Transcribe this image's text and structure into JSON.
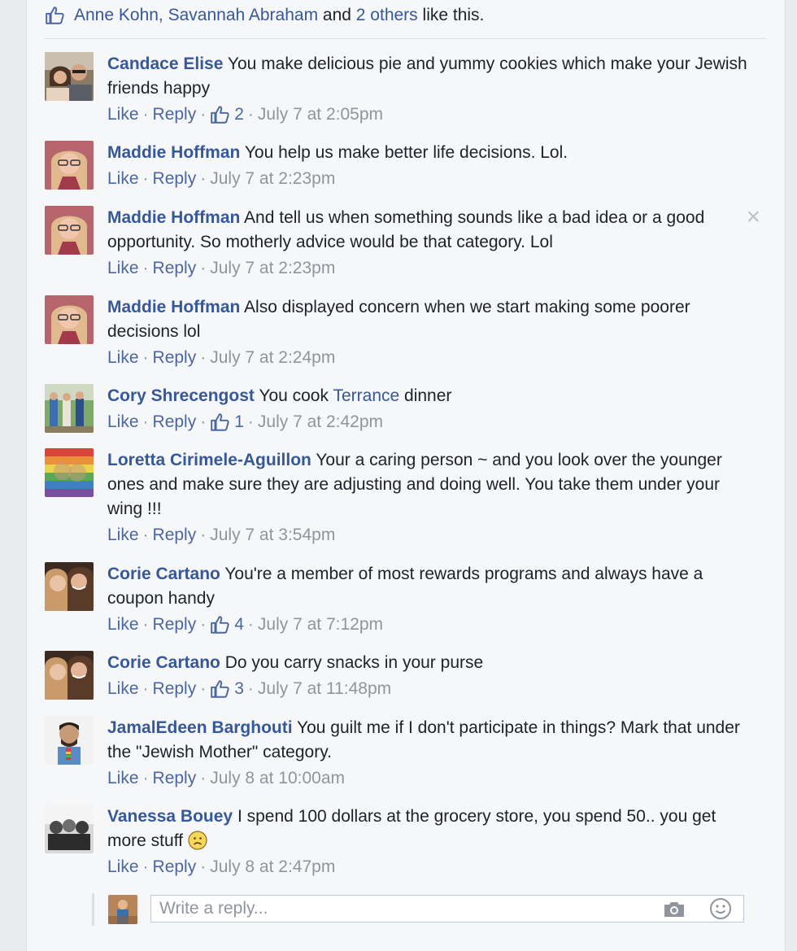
{
  "likes": {
    "names": "Anne Kohn, Savannah Abraham",
    "and": "and",
    "others": "2 others",
    "suffix": "like this."
  },
  "actions": {
    "like": "Like",
    "reply": "Reply",
    "separator": "·"
  },
  "comments": [
    {
      "author": "Candace Elise",
      "text": "You make delicious pie and yummy cookies which make your Jewish friends happy",
      "likes": "2",
      "time": "July 7 at 2:05pm"
    },
    {
      "author": "Maddie Hoffman",
      "text": "You help us make better life decisions. Lol.",
      "time": "July 7 at 2:23pm"
    },
    {
      "author": "Maddie Hoffman",
      "text": "And tell us when something sounds like a bad idea or a good opportunity. So motherly advice would be that category. Lol",
      "time": "July 7 at 2:23pm"
    },
    {
      "author": "Maddie Hoffman",
      "text": "Also displayed concern when we start making some poorer decisions lol",
      "time": "July 7 at 2:24pm"
    },
    {
      "author": "Cory Shrecengost",
      "text_before": "You cook",
      "mention": "Terrance",
      "text_after": "dinner",
      "likes": "1",
      "time": "July 7 at 2:42pm"
    },
    {
      "author": "Loretta Cirimele-Aguillon",
      "text": "Your a caring person ~ and you look over the younger ones and make sure they are adjusting and doing well. You take them under your wing !!!",
      "time": "July 7 at 3:54pm"
    },
    {
      "author": "Corie Cartano",
      "text": "You're a member of most rewards programs and always have a coupon handy",
      "likes": "4",
      "time": "July 7 at 7:12pm"
    },
    {
      "author": "Corie Cartano",
      "text": "Do you carry snacks in your purse",
      "likes": "3",
      "time": "July 7 at 11:48pm"
    },
    {
      "author": "JamalEdeen Barghouti",
      "text": "You guilt me if I don't participate in things? Mark that under the \"Jewish Mother\" category.",
      "time": "July 8 at 10:00am"
    },
    {
      "author": "Vanessa Bouey",
      "text": "I spend 100 dollars at the grocery store, you spend 50.. you get more stuff",
      "time": "July 8 at 2:47pm"
    }
  ],
  "reply_box": {
    "placeholder": "Write a reply..."
  },
  "icons": {
    "thumb": "thumbs-up-icon",
    "close": "close-icon",
    "camera": "camera-icon",
    "emoji": "smiley-icon",
    "frown": "frown-emoji-icon"
  },
  "colors": {
    "link": "#365899",
    "muted": "#90949c",
    "action": "#4b67a1",
    "background": "#f6f7f9"
  }
}
